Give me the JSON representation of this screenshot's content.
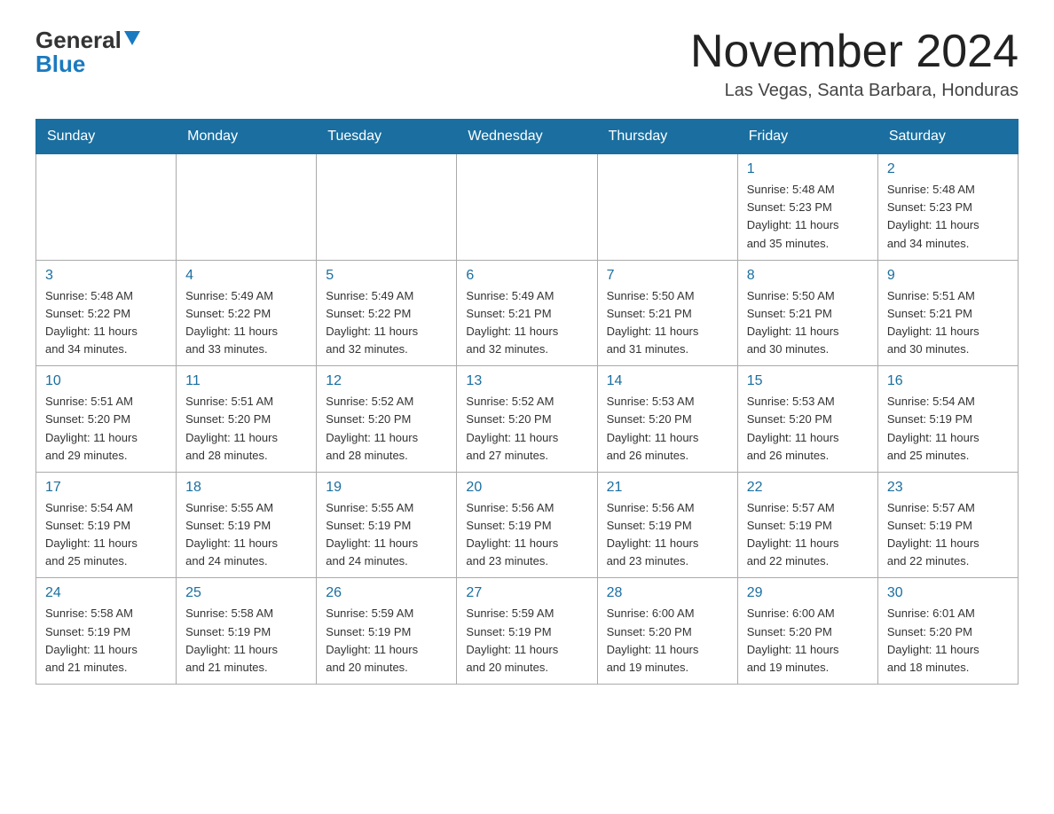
{
  "header": {
    "logo_main": "General",
    "logo_blue": "Blue",
    "month_title": "November 2024",
    "location": "Las Vegas, Santa Barbara, Honduras"
  },
  "weekdays": [
    "Sunday",
    "Monday",
    "Tuesday",
    "Wednesday",
    "Thursday",
    "Friday",
    "Saturday"
  ],
  "weeks": [
    [
      {
        "day": "",
        "info": ""
      },
      {
        "day": "",
        "info": ""
      },
      {
        "day": "",
        "info": ""
      },
      {
        "day": "",
        "info": ""
      },
      {
        "day": "",
        "info": ""
      },
      {
        "day": "1",
        "info": "Sunrise: 5:48 AM\nSunset: 5:23 PM\nDaylight: 11 hours\nand 35 minutes."
      },
      {
        "day": "2",
        "info": "Sunrise: 5:48 AM\nSunset: 5:23 PM\nDaylight: 11 hours\nand 34 minutes."
      }
    ],
    [
      {
        "day": "3",
        "info": "Sunrise: 5:48 AM\nSunset: 5:22 PM\nDaylight: 11 hours\nand 34 minutes."
      },
      {
        "day": "4",
        "info": "Sunrise: 5:49 AM\nSunset: 5:22 PM\nDaylight: 11 hours\nand 33 minutes."
      },
      {
        "day": "5",
        "info": "Sunrise: 5:49 AM\nSunset: 5:22 PM\nDaylight: 11 hours\nand 32 minutes."
      },
      {
        "day": "6",
        "info": "Sunrise: 5:49 AM\nSunset: 5:21 PM\nDaylight: 11 hours\nand 32 minutes."
      },
      {
        "day": "7",
        "info": "Sunrise: 5:50 AM\nSunset: 5:21 PM\nDaylight: 11 hours\nand 31 minutes."
      },
      {
        "day": "8",
        "info": "Sunrise: 5:50 AM\nSunset: 5:21 PM\nDaylight: 11 hours\nand 30 minutes."
      },
      {
        "day": "9",
        "info": "Sunrise: 5:51 AM\nSunset: 5:21 PM\nDaylight: 11 hours\nand 30 minutes."
      }
    ],
    [
      {
        "day": "10",
        "info": "Sunrise: 5:51 AM\nSunset: 5:20 PM\nDaylight: 11 hours\nand 29 minutes."
      },
      {
        "day": "11",
        "info": "Sunrise: 5:51 AM\nSunset: 5:20 PM\nDaylight: 11 hours\nand 28 minutes."
      },
      {
        "day": "12",
        "info": "Sunrise: 5:52 AM\nSunset: 5:20 PM\nDaylight: 11 hours\nand 28 minutes."
      },
      {
        "day": "13",
        "info": "Sunrise: 5:52 AM\nSunset: 5:20 PM\nDaylight: 11 hours\nand 27 minutes."
      },
      {
        "day": "14",
        "info": "Sunrise: 5:53 AM\nSunset: 5:20 PM\nDaylight: 11 hours\nand 26 minutes."
      },
      {
        "day": "15",
        "info": "Sunrise: 5:53 AM\nSunset: 5:20 PM\nDaylight: 11 hours\nand 26 minutes."
      },
      {
        "day": "16",
        "info": "Sunrise: 5:54 AM\nSunset: 5:19 PM\nDaylight: 11 hours\nand 25 minutes."
      }
    ],
    [
      {
        "day": "17",
        "info": "Sunrise: 5:54 AM\nSunset: 5:19 PM\nDaylight: 11 hours\nand 25 minutes."
      },
      {
        "day": "18",
        "info": "Sunrise: 5:55 AM\nSunset: 5:19 PM\nDaylight: 11 hours\nand 24 minutes."
      },
      {
        "day": "19",
        "info": "Sunrise: 5:55 AM\nSunset: 5:19 PM\nDaylight: 11 hours\nand 24 minutes."
      },
      {
        "day": "20",
        "info": "Sunrise: 5:56 AM\nSunset: 5:19 PM\nDaylight: 11 hours\nand 23 minutes."
      },
      {
        "day": "21",
        "info": "Sunrise: 5:56 AM\nSunset: 5:19 PM\nDaylight: 11 hours\nand 23 minutes."
      },
      {
        "day": "22",
        "info": "Sunrise: 5:57 AM\nSunset: 5:19 PM\nDaylight: 11 hours\nand 22 minutes."
      },
      {
        "day": "23",
        "info": "Sunrise: 5:57 AM\nSunset: 5:19 PM\nDaylight: 11 hours\nand 22 minutes."
      }
    ],
    [
      {
        "day": "24",
        "info": "Sunrise: 5:58 AM\nSunset: 5:19 PM\nDaylight: 11 hours\nand 21 minutes."
      },
      {
        "day": "25",
        "info": "Sunrise: 5:58 AM\nSunset: 5:19 PM\nDaylight: 11 hours\nand 21 minutes."
      },
      {
        "day": "26",
        "info": "Sunrise: 5:59 AM\nSunset: 5:19 PM\nDaylight: 11 hours\nand 20 minutes."
      },
      {
        "day": "27",
        "info": "Sunrise: 5:59 AM\nSunset: 5:19 PM\nDaylight: 11 hours\nand 20 minutes."
      },
      {
        "day": "28",
        "info": "Sunrise: 6:00 AM\nSunset: 5:20 PM\nDaylight: 11 hours\nand 19 minutes."
      },
      {
        "day": "29",
        "info": "Sunrise: 6:00 AM\nSunset: 5:20 PM\nDaylight: 11 hours\nand 19 minutes."
      },
      {
        "day": "30",
        "info": "Sunrise: 6:01 AM\nSunset: 5:20 PM\nDaylight: 11 hours\nand 18 minutes."
      }
    ]
  ]
}
